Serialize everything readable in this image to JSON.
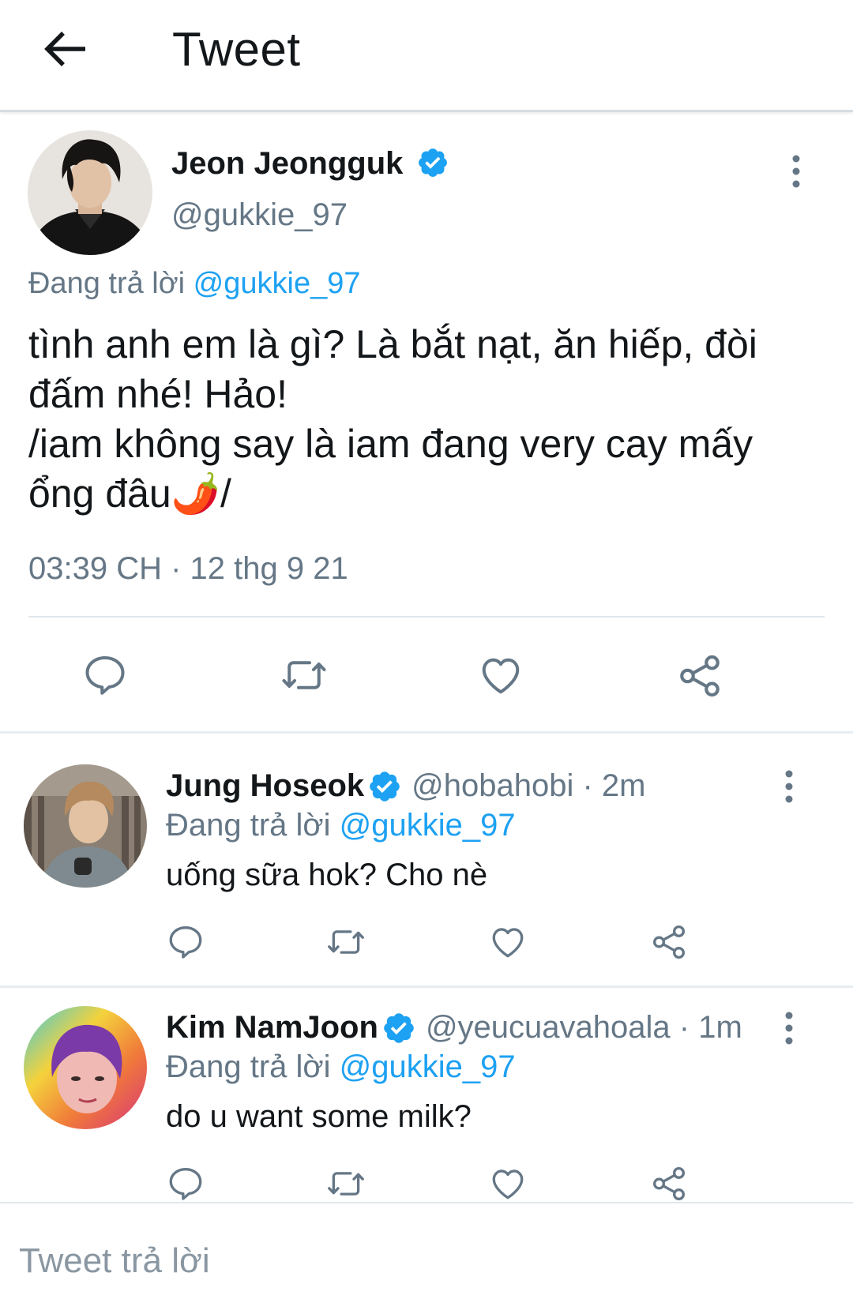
{
  "header": {
    "title": "Tweet",
    "back_icon": "arrow-left-icon"
  },
  "main_tweet": {
    "author_name": "Jeon Jeongguk",
    "author_handle": "@gukkie_97",
    "replying_prefix": "Đang trả lời",
    "replying_to": "@gukkie_97",
    "text": "tình anh em là gì? Là bắt nạt, ăn hiếp, đòi đấm nhé! Hảo!\n/iam không say là iam đang very cay mấy ổng đâu🌶️/",
    "timestamp": "03:39 CH · 12 thg 9 21",
    "actions": [
      "reply-icon",
      "retweet-icon",
      "like-icon",
      "share-icon"
    ]
  },
  "replies": [
    {
      "author_name": "Jung Hoseok",
      "handle_time": "@hobahobi · 2m",
      "replying_prefix": "Đang trả lời",
      "replying_to": "@gukkie_97",
      "text": "uống sữa hok? Cho nè"
    },
    {
      "author_name": "Kim NamJoon",
      "handle_time": "@yeucuavahoala · 1m",
      "replying_prefix": "Đang trả lời",
      "replying_to": "@gukkie_97",
      "text": "do u want some milk?"
    }
  ],
  "composer": {
    "placeholder": "Tweet trả lời"
  },
  "colors": {
    "accent": "#1da1f2",
    "text": "#14171a",
    "secondary": "#657786",
    "divider": "#e1e8ed",
    "icon": "#657786"
  }
}
